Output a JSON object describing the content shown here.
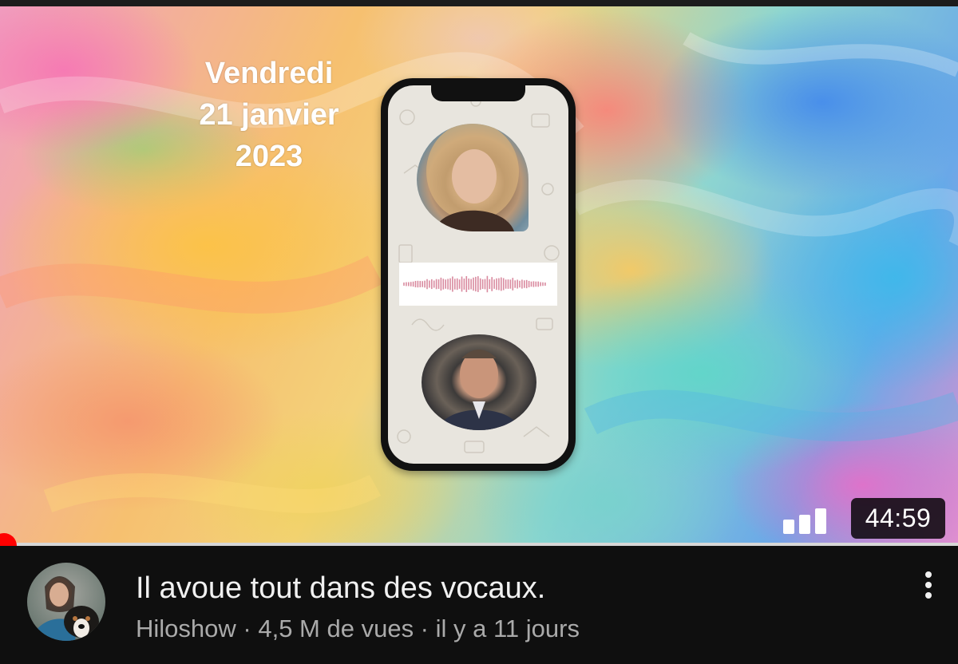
{
  "thumbnail": {
    "date_lines": [
      "Vendredi",
      "21 janvier",
      "2023"
    ],
    "duration": "44:59",
    "watch_progress": 0.0
  },
  "video": {
    "title": "Il avoue tout dans des vocaux.",
    "channel": "Hiloshow",
    "separator": " · ",
    "views": "4,5 M de vues",
    "age": "il y a 11 jours"
  },
  "icons": {
    "audio_bars": "bar-chart-icon",
    "more": "more-vertical-icon"
  },
  "colors": {
    "background": "#0f0f0f",
    "title": "#f1f1f1",
    "meta": "#aaaaaa",
    "progress": "#ff0000"
  }
}
